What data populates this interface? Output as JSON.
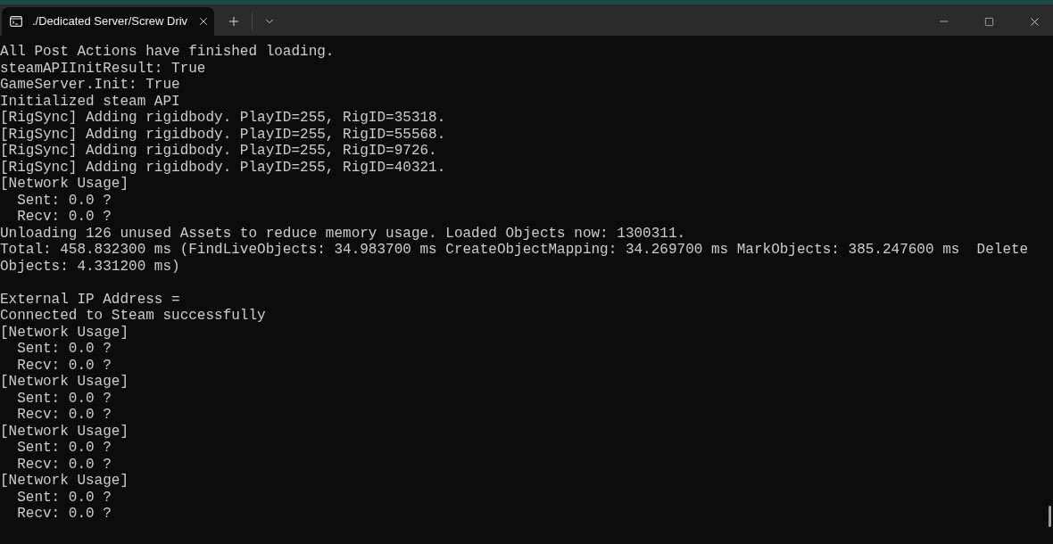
{
  "tab": {
    "title": "./Dedicated Server/Screw Driv",
    "selected": true
  },
  "output_blocks": [
    {
      "lines": [
        "All Post Actions have finished loading.",
        "steamAPIInitResult: True",
        "GameServer.Init: True",
        "Initialized steam API",
        "[RigSync] Adding rigidbody. PlayID=255, RigID=35318.",
        "[RigSync] Adding rigidbody. PlayID=255, RigID=55568.",
        "[RigSync] Adding rigidbody. PlayID=255, RigID=9726.",
        "[RigSync] Adding rigidbody. PlayID=255, RigID=40321.",
        "[Network Usage]",
        "  Sent: 0.0 ?",
        "  Recv: 0.0 ?",
        "Unloading 126 unused Assets to reduce memory usage. Loaded Objects now: 1300311.",
        "Total: 458.832300 ms (FindLiveObjects: 34.983700 ms CreateObjectMapping: 34.269700 ms MarkObjects: 385.247600 ms  Delete",
        "Objects: 4.331200 ms)"
      ]
    },
    {
      "lines": [
        "External IP Address =",
        "Connected to Steam successfully",
        "[Network Usage]",
        "  Sent: 0.0 ?",
        "  Recv: 0.0 ?",
        "[Network Usage]",
        "  Sent: 0.0 ?",
        "  Recv: 0.0 ?",
        "[Network Usage]",
        "  Sent: 0.0 ?",
        "  Recv: 0.0 ?",
        "[Network Usage]",
        "  Sent: 0.0 ?",
        "  Recv: 0.0 ?"
      ]
    }
  ]
}
